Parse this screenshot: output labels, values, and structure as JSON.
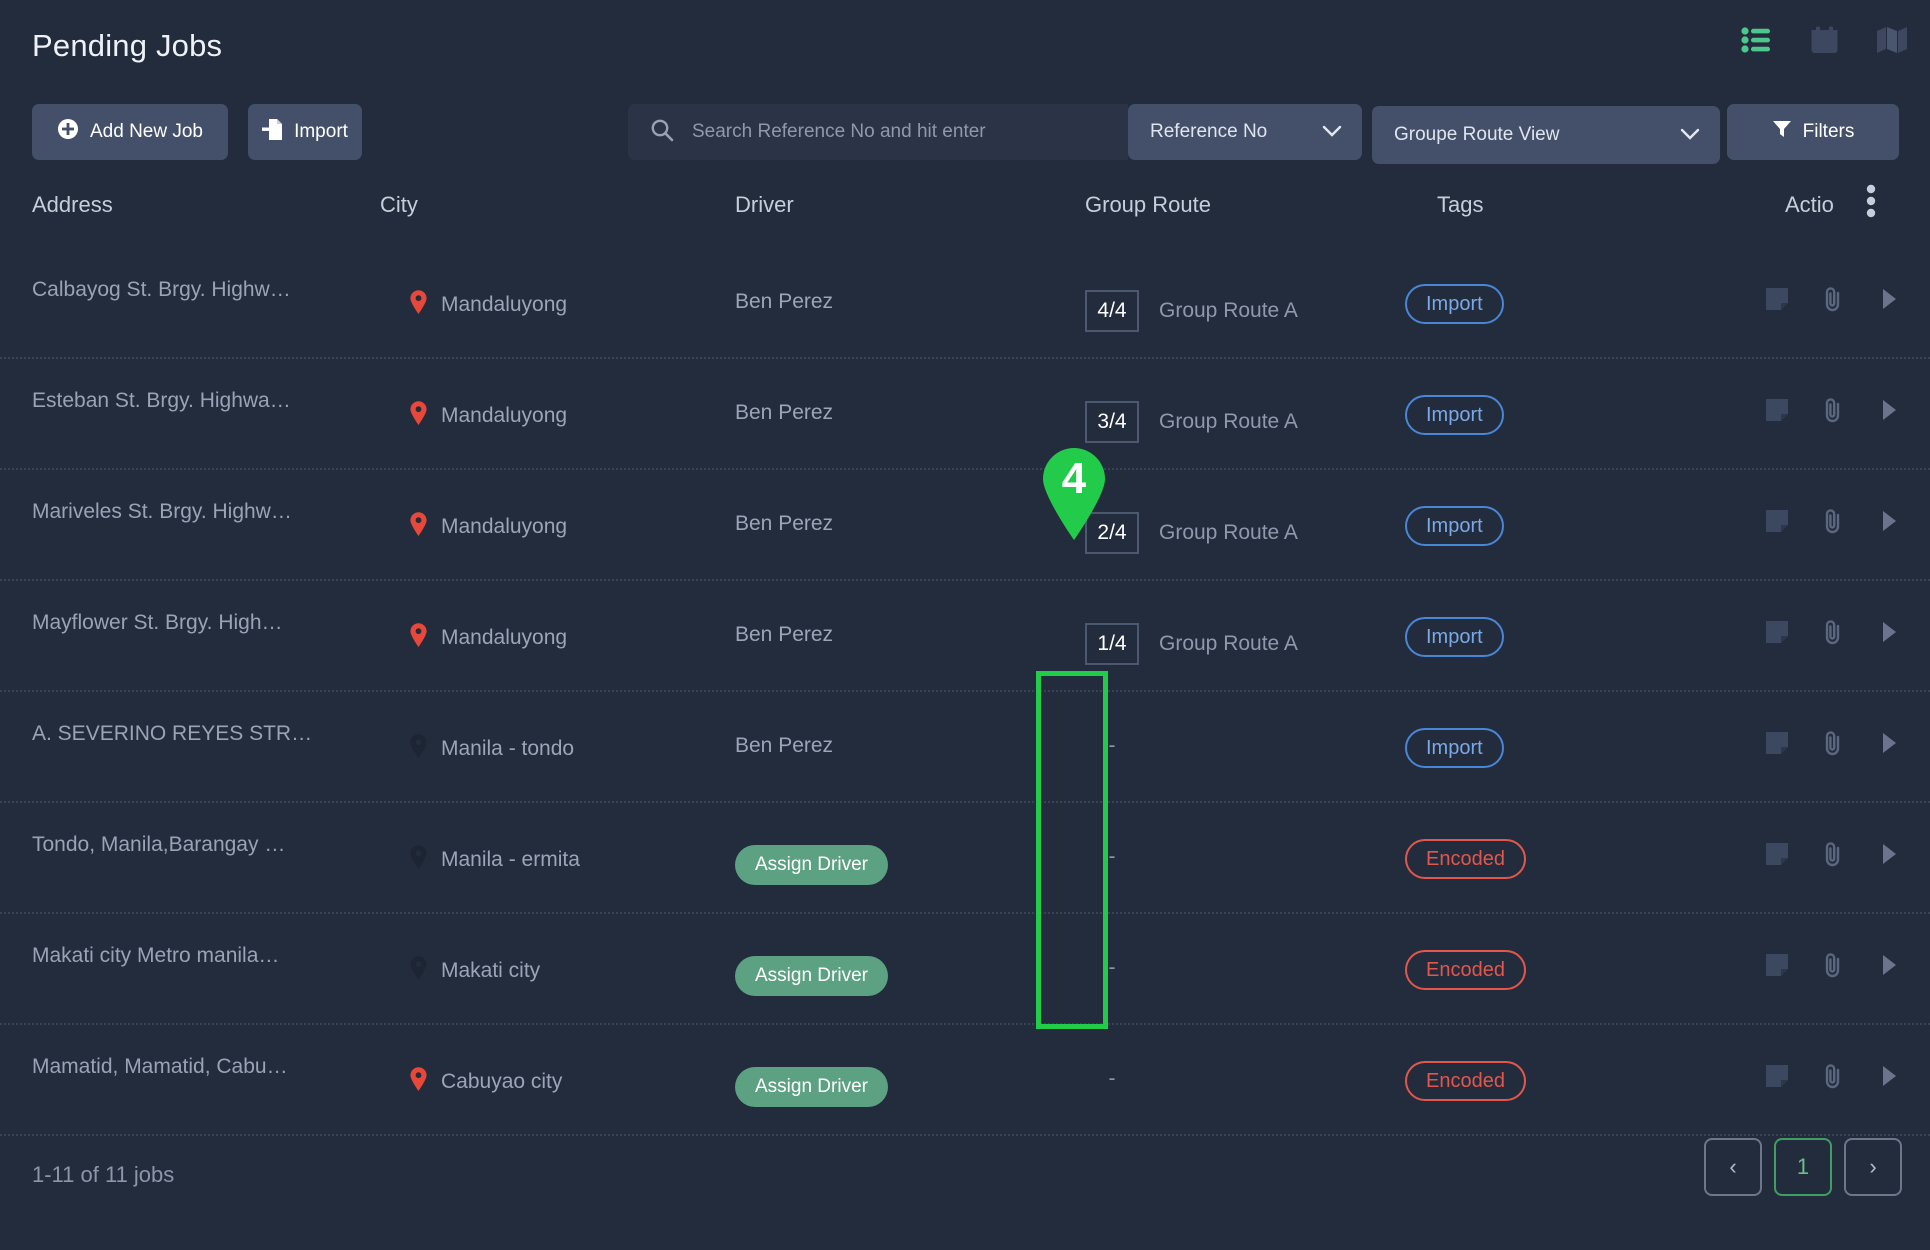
{
  "header": {
    "title": "Pending Jobs",
    "view_icons": [
      {
        "name": "list-view-icon",
        "label": "List View",
        "active": true
      },
      {
        "name": "calendar-view-icon",
        "label": "Calendar View",
        "active": false
      },
      {
        "name": "map-view-icon",
        "label": "Map View",
        "active": false
      }
    ]
  },
  "toolbar": {
    "add_label": "Add New Job",
    "import_label": "Import",
    "filters_label": "Filters",
    "search_placeholder": "Search Reference No and hit enter",
    "search_value": "",
    "search_field_selected": "Reference No",
    "view_selected": "Groupe Route View"
  },
  "table": {
    "columns": [
      "Address",
      "City",
      "Driver",
      "Group Route",
      "Tags",
      "Actio"
    ],
    "rows": [
      {
        "address": "Calbayog St. Brgy. Highw…",
        "city": "Mandaluyong",
        "pin": "red",
        "driver": "Ben Perez",
        "driver_type": "text",
        "seq": "4/4",
        "route": "Group Route A",
        "tag": "Import",
        "tag_type": "import"
      },
      {
        "address": "Esteban St. Brgy. Highwa…",
        "city": "Mandaluyong",
        "pin": "red",
        "driver": "Ben Perez",
        "driver_type": "text",
        "seq": "3/4",
        "route": "Group Route A",
        "tag": "Import",
        "tag_type": "import"
      },
      {
        "address": "Mariveles St. Brgy. Highw…",
        "city": "Mandaluyong",
        "pin": "red",
        "driver": "Ben Perez",
        "driver_type": "text",
        "seq": "2/4",
        "route": "Group Route A",
        "tag": "Import",
        "tag_type": "import"
      },
      {
        "address": "Mayflower St. Brgy. High…",
        "city": "Mandaluyong",
        "pin": "red",
        "driver": "Ben Perez",
        "driver_type": "text",
        "seq": "1/4",
        "route": "Group Route A",
        "tag": "Import",
        "tag_type": "import"
      },
      {
        "address": "A. SEVERINO REYES STR…",
        "city": "Manila - tondo",
        "pin": "dark",
        "driver": "Ben Perez",
        "driver_type": "text",
        "seq": "-",
        "route": "",
        "tag": "Import",
        "tag_type": "import"
      },
      {
        "address": "Tondo, Manila,Barangay …",
        "city": "Manila - ermita",
        "pin": "dark",
        "driver": "Assign Driver",
        "driver_type": "button",
        "seq": "-",
        "route": "",
        "tag": "Encoded",
        "tag_type": "encoded"
      },
      {
        "address": "Makati city Metro manila…",
        "city": "Makati city",
        "pin": "dark",
        "driver": "Assign Driver",
        "driver_type": "button",
        "seq": "-",
        "route": "",
        "tag": "Encoded",
        "tag_type": "encoded"
      },
      {
        "address": "Mamatid, Mamatid, Cabu…",
        "city": "Cabuyao city",
        "pin": "red",
        "driver": "Assign Driver",
        "driver_type": "button",
        "seq": "-",
        "route": "",
        "tag": "Encoded",
        "tag_type": "encoded"
      }
    ],
    "row_actions": [
      "note-icon",
      "attachment-icon",
      "expand-icon"
    ]
  },
  "annotation": {
    "marker_number": "4",
    "marker_color": "#22cc4a",
    "highlight_color": "#22cc4a"
  },
  "footer": {
    "jobs_count": "1-11 of 11 jobs",
    "prev_label": "‹",
    "page_label": "1",
    "next_label": "›"
  },
  "colors": {
    "background": "#232c3d",
    "button": "#445069",
    "search_bg": "#2b3447",
    "accent_green": "#22cc4a",
    "assign_green": "#5da183",
    "tag_import": "#4a86d6",
    "tag_encoded": "#e2574c",
    "pin_red": "#e8483a",
    "pin_dark": "#1d2433"
  }
}
